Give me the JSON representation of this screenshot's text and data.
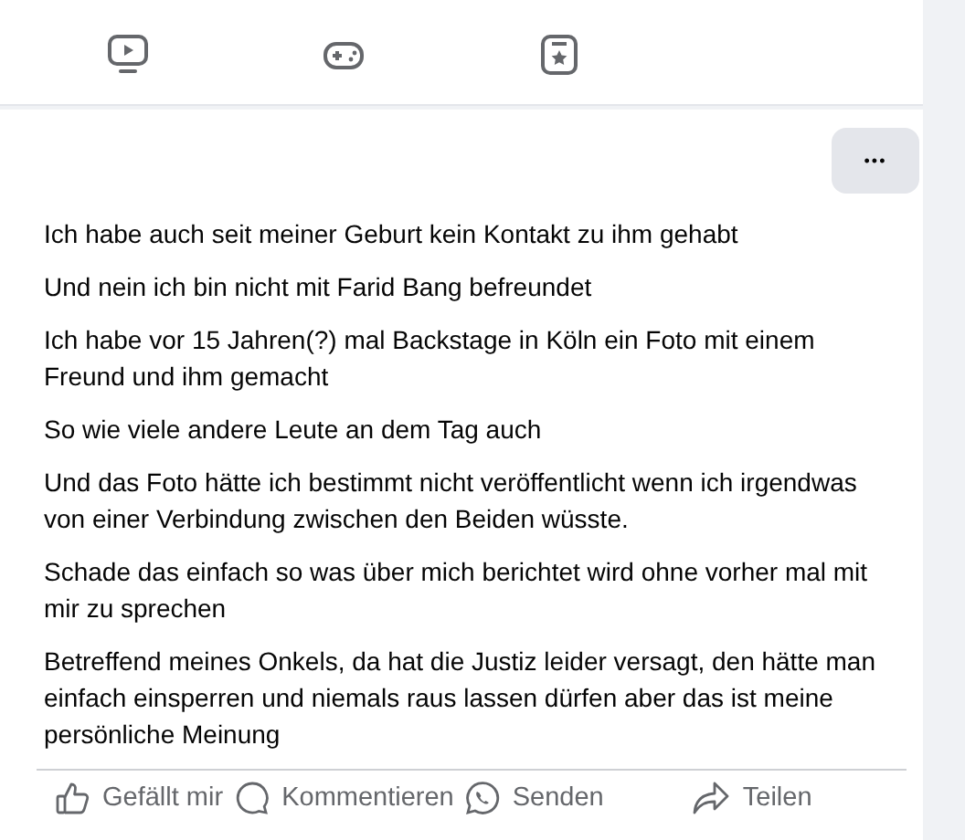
{
  "nav_icons": [
    {
      "kind": "video"
    },
    {
      "kind": "gaming"
    },
    {
      "kind": "saved"
    }
  ],
  "post": {
    "more_button": "•••",
    "paragraphs": [
      "Ich habe auch seit meiner Geburt kein Kontakt zu ihm gehabt",
      "Und nein ich bin nicht mit Farid Bang befreundet",
      "Ich habe vor 15 Jahren(?) mal Backstage in Köln ein Foto mit einem Freund und ihm gemacht",
      "So wie viele andere Leute an dem Tag auch",
      "Und das Foto hätte ich bestimmt nicht veröffentlicht wenn ich irgendwas von einer Verbindung zwischen den Beiden wüsste.",
      "Schade das einfach so was über mich berichtet wird ohne vorher mal mit mir zu sprechen",
      "Betreffend meines Onkels, da hat die Justiz leider versagt, den hätte man einfach einsperren und niemals raus lassen dürfen aber das ist meine persönliche Meinung"
    ],
    "actions": [
      {
        "kind": "like",
        "label": "Gefällt mir"
      },
      {
        "kind": "comment",
        "label": "Kommentieren"
      },
      {
        "kind": "send",
        "label": "Senden"
      },
      {
        "kind": "share",
        "label": "Teilen"
      }
    ]
  }
}
